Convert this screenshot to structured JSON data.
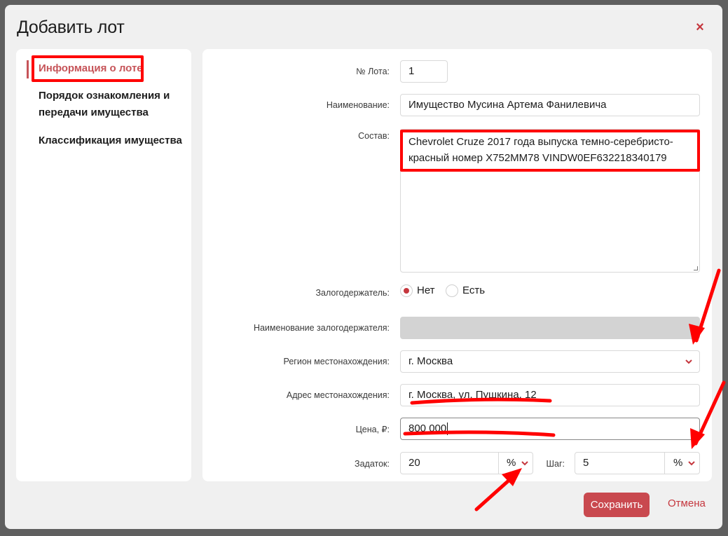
{
  "modal": {
    "title": "Добавить лот",
    "close_symbol": "×"
  },
  "sidebar": {
    "items": [
      {
        "label": "Информация о лоте",
        "active": true
      },
      {
        "label": "Порядок ознакомления и передачи имущества"
      },
      {
        "label": "Классификация имущества"
      }
    ]
  },
  "form": {
    "lot_number": {
      "label": "№ Лота:",
      "value": "1"
    },
    "name": {
      "label": "Наименование:",
      "value": "Имущество Мусина Артема Фанилевича"
    },
    "composition": {
      "label": "Состав:",
      "value": "Chevrolet Cruze 2017 года выпуска темно-серебристо-красный номер Х752ММ78 VINDW0EF632218340179"
    },
    "pledgeholder": {
      "label": "Залогодержатель:",
      "options": [
        "Нет",
        "Есть"
      ],
      "selected": "Нет"
    },
    "pledgeholder_name": {
      "label": "Наименование залогодержателя:",
      "value": ""
    },
    "region": {
      "label": "Регион местонахождения:",
      "value": "г. Москва"
    },
    "address": {
      "label": "Адрес местонахождения:",
      "value": "г. Москва, ул. Пушкина, 12"
    },
    "price": {
      "label": "Цена, ₽:",
      "value": "800 000"
    },
    "deposit": {
      "label": "Задаток:",
      "value": "20",
      "unit": "%"
    },
    "step": {
      "label": "Шаг:",
      "value": "5",
      "unit": "%"
    }
  },
  "footer": {
    "save_label": "Сохранить",
    "cancel_label": "Отмена"
  },
  "colors": {
    "accent": "#c5373e",
    "annotation_red": "#ff0000",
    "overlay": "#5f5f5f",
    "modal_bg": "#f0f0f0"
  },
  "icons": {
    "close": "close-icon",
    "dropdown": "chevron-down-icon"
  }
}
